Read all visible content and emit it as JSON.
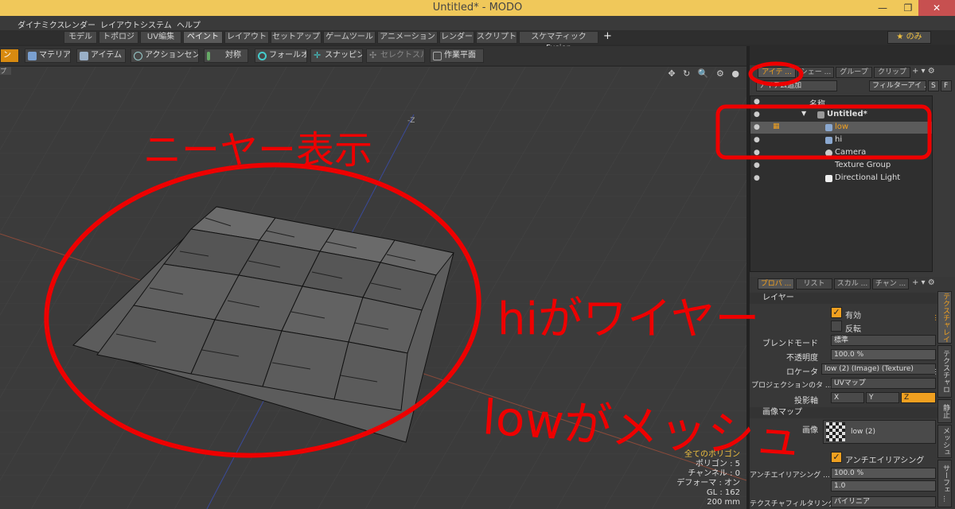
{
  "window": {
    "title": "Untitled* - MODO",
    "minimize": "—",
    "maximize": "❐",
    "close": "✕"
  },
  "menu": [
    "ダイナミクス",
    "レンダー",
    "レイアウト",
    "システム",
    "ヘルプ"
  ],
  "tabs": {
    "items": [
      "モデル",
      "トポロジ",
      "UV編集",
      "ペイント",
      "レイアウト",
      "セットアップ",
      "ゲームツール",
      "アニメーション",
      "レンダー",
      "スクリプト",
      "スケマティックFusion"
    ],
    "active": "ペイント",
    "add": "+",
    "favorite": "★ のみ"
  },
  "toolbar": {
    "mode": "ン",
    "material": "マテリアル",
    "item": "アイテム",
    "action_center": "アクションセンター",
    "symmetry": "対称",
    "falloff": "フォールオフ",
    "snapping": "スナッピング",
    "select_through": "セレクトスルー",
    "work_plane": "作業平面"
  },
  "viewport": {
    "corner_tag": "プ",
    "icons": "✥ ↻ 🔍 ⚙ ●",
    "axis_label": "-Z",
    "stats": {
      "line1": "全てのポリゴン",
      "line2": "ポリゴン : 5",
      "line3": "チャンネル : 0",
      "line4": "デフォーマ : オン",
      "line5": "GL : 162",
      "line6": "200 mm"
    }
  },
  "items_panel": {
    "tabs": [
      "アイテ ...",
      "シェー ...",
      "グループ",
      "クリップ"
    ],
    "add_item": "アイテム追加",
    "filter": "フィルターアイ ...",
    "s": "S",
    "f": "F",
    "col_name": "名称",
    "tree": [
      {
        "name": "Untitled*",
        "indent": 0
      },
      {
        "name": "low",
        "indent": 1
      },
      {
        "name": "hi",
        "indent": 1
      },
      {
        "name": "Camera",
        "indent": 1
      },
      {
        "name": "Texture Group",
        "indent": 1
      },
      {
        "name": "Directional Light",
        "indent": 1
      }
    ]
  },
  "props_panel": {
    "tabs": [
      "プロパ ...",
      "リスト",
      "スカル ...",
      "チャン ..."
    ],
    "section_layer": "レイヤー",
    "enable": "有効",
    "invert": "反転",
    "blend_mode_label": "ブレンドモード",
    "blend_mode": "標準",
    "opacity_label": "不透明度",
    "opacity": "100.0 %",
    "locator_label": "ロケータ",
    "locator": "low (2) (Image) (Texture)",
    "projection_label": "プロジェクションのタ ...",
    "projection": "UVマップ",
    "proj_axis_label": "投影軸",
    "axes": [
      "X",
      "Y",
      "Z"
    ],
    "active_axis": "Z",
    "section_image": "画像マップ",
    "image_label": "画像",
    "image": "low (2)",
    "antialias": "アンチエイリアシング",
    "antialias_label": "アンチエイリアシング ...",
    "antialias_value": "100.0 %",
    "strength_value": "1.0",
    "texture_filter_label": "テクスチャフィルタリング",
    "texture_filter": "バイリニア",
    "side_tabs": [
      "テクスチャレイ ...",
      "テクスチャロ ...",
      "静止",
      "メッシュ",
      "サーフェ ..."
    ]
  },
  "annotations": {
    "text1": "ニーヤー表示",
    "text2": "hiがワイヤー",
    "text3": "lowがメッシュ"
  }
}
